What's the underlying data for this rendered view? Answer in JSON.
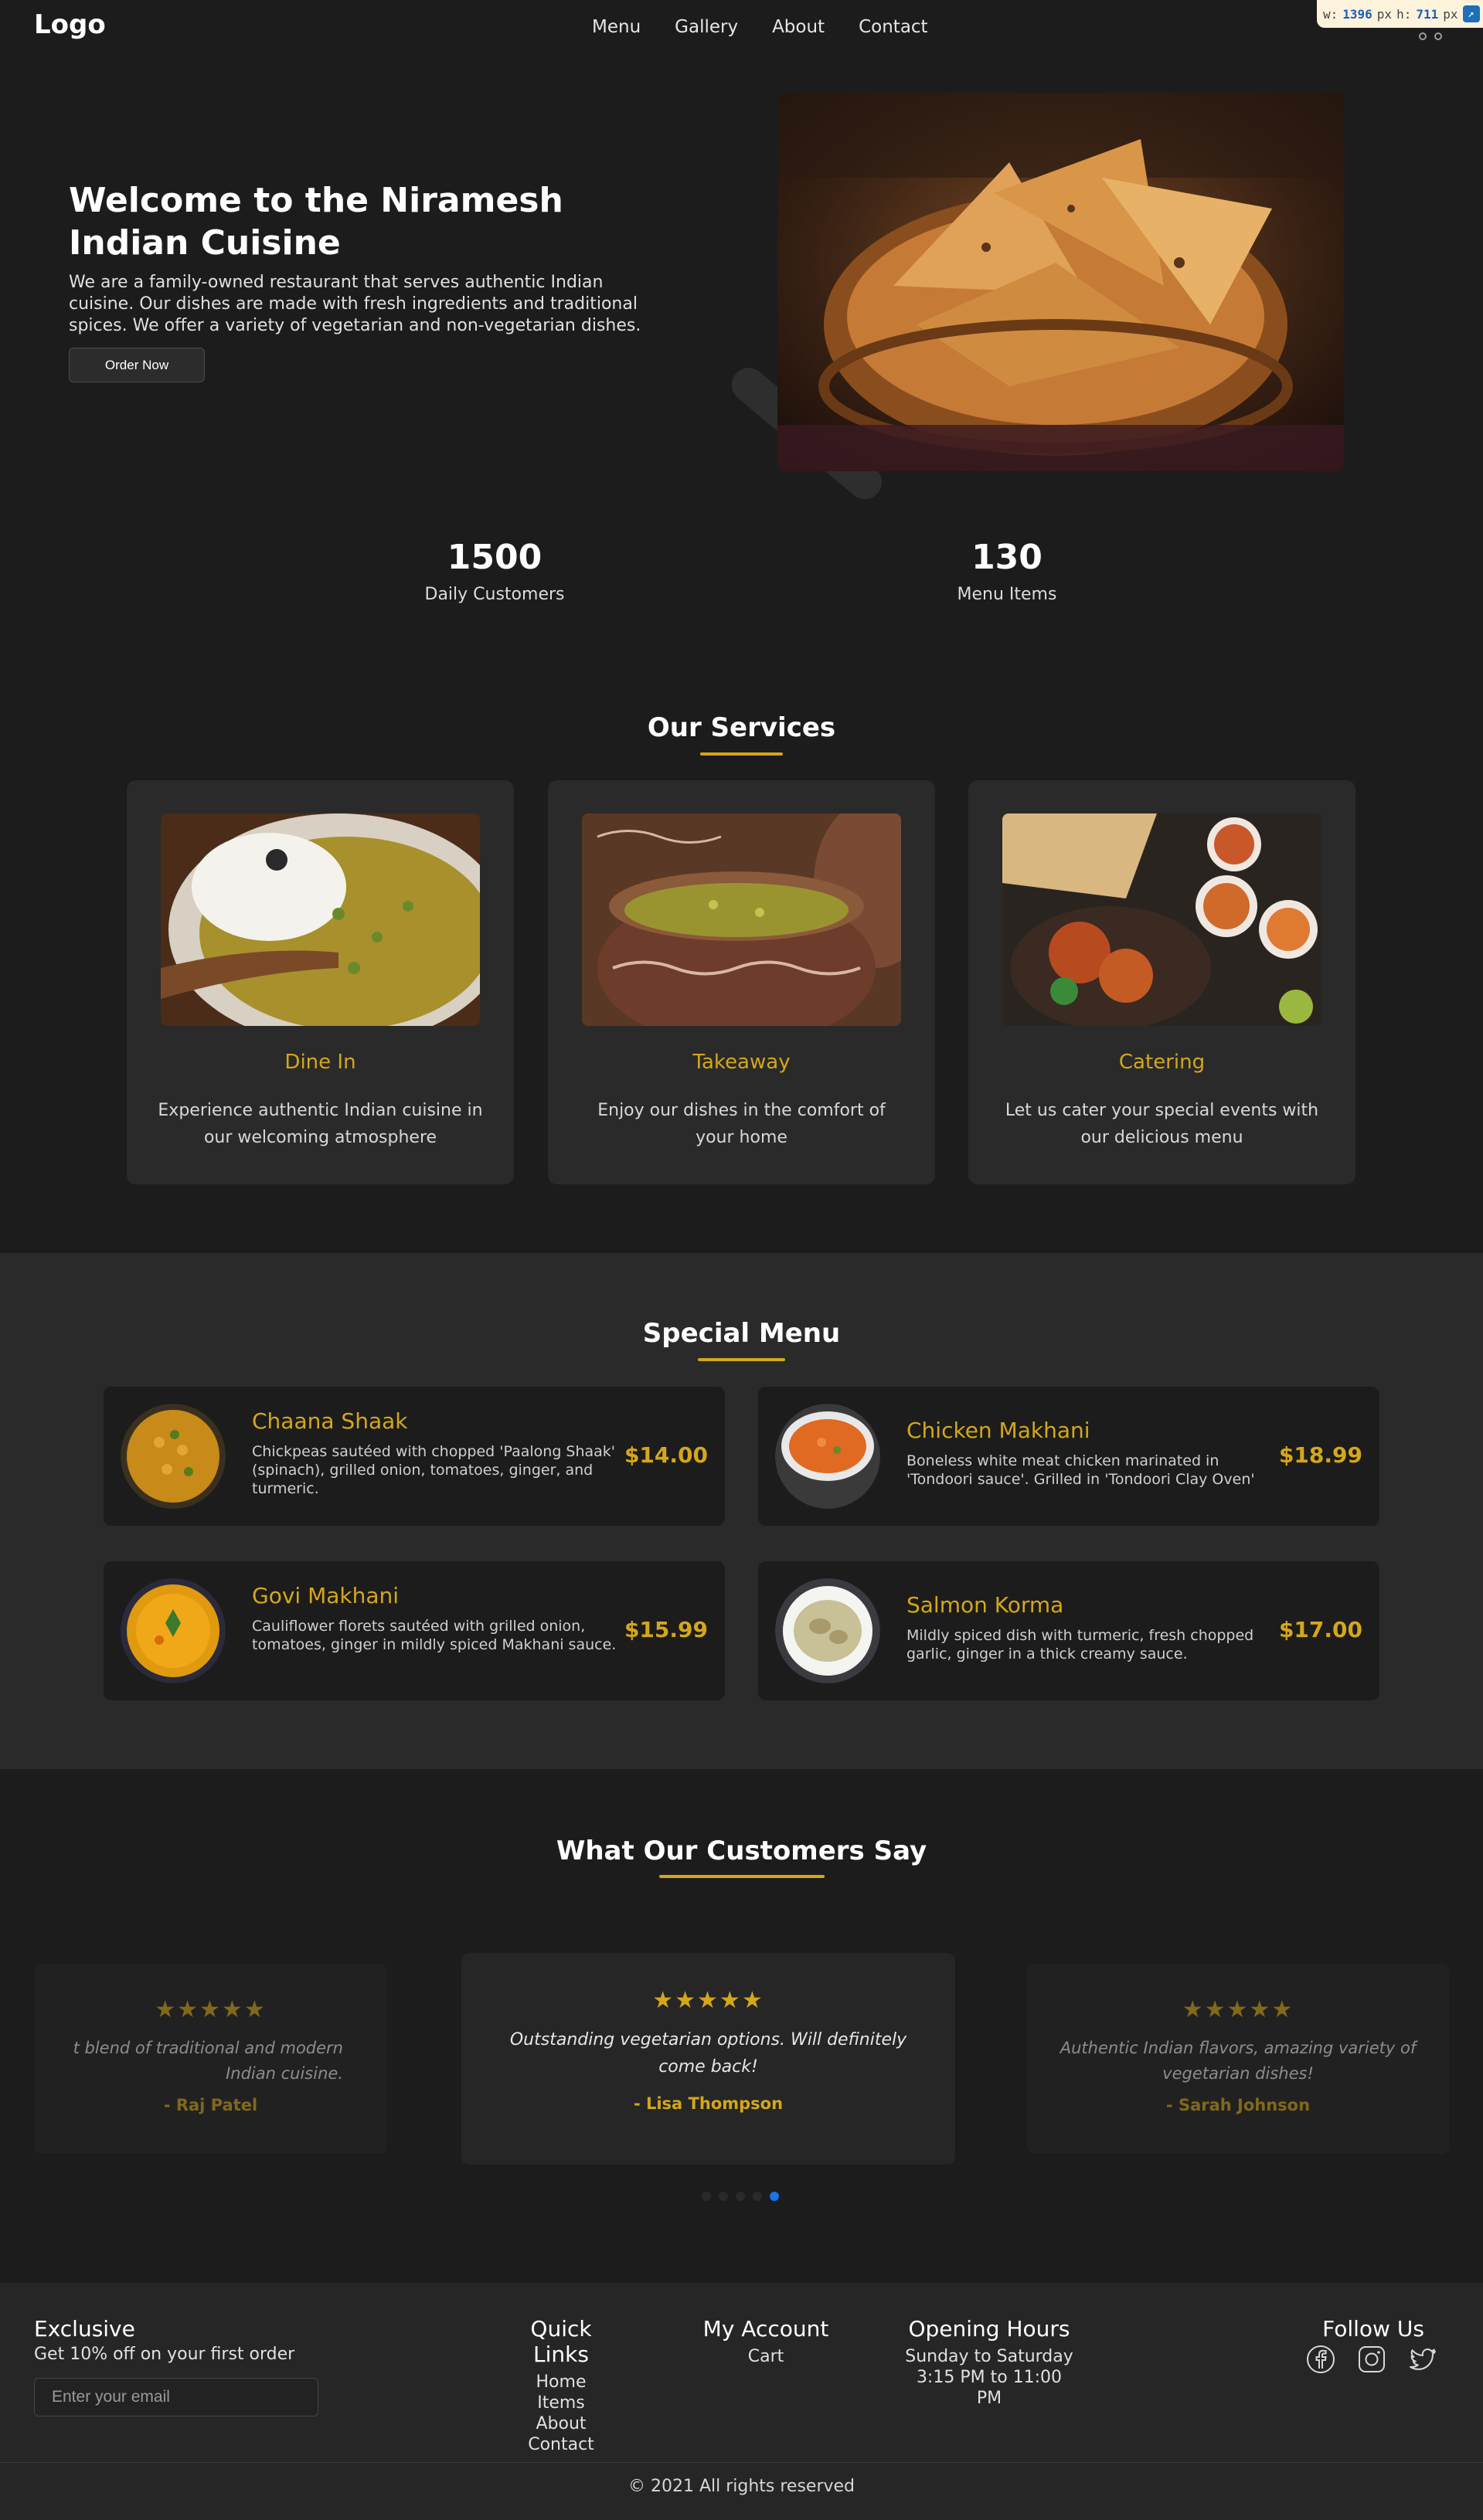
{
  "header": {
    "logo": "Logo",
    "nav": [
      "Menu",
      "Gallery",
      "About",
      "Contact"
    ]
  },
  "devtools": {
    "w_label": "w:",
    "w_value": "1396",
    "w_unit": "px",
    "h_label": "h:",
    "h_value": "711",
    "h_unit": "px"
  },
  "hero": {
    "title": "Welcome to the Niramesh Indian Cuisine",
    "text": "We are a family-owned restaurant that serves authentic Indian cuisine. Our dishes are made with fresh ingredients and traditional spices. We offer a variety of vegetarian and non-vegetarian dishes.",
    "button": "Order Now"
  },
  "stats": [
    {
      "value": "1500",
      "label": "Daily Customers"
    },
    {
      "value": "130",
      "label": "Menu Items"
    }
  ],
  "services": {
    "title": "Our Services",
    "items": [
      {
        "title": "Dine In",
        "desc": "Experience authentic Indian cuisine in our welcoming atmosphere"
      },
      {
        "title": "Takeaway",
        "desc": "Enjoy our dishes in the comfort of your home"
      },
      {
        "title": "Catering",
        "desc": "Let us cater your special events with our delicious menu"
      }
    ]
  },
  "special_menu": {
    "title": "Special Menu",
    "items": [
      {
        "name": "Chaana Shaak",
        "desc": "Chickpeas sautéed with chopped 'Paalong Shaak' (spinach), grilled onion, tomatoes, ginger, and turmeric.",
        "price": "$14.00"
      },
      {
        "name": "Chicken Makhani",
        "desc": "Boneless white meat chicken marinated in 'Tondoori sauce'. Grilled in 'Tondoori Clay Oven'",
        "price": "$18.99"
      },
      {
        "name": "Govi Makhani",
        "desc": "Cauliflower florets sautéed with grilled onion, tomatoes, ginger in mildly spiced Makhani sauce.",
        "price": "$15.99"
      },
      {
        "name": "Salmon Korma",
        "desc": "Mildly spiced dish with turmeric, fresh chopped garlic, ginger in a thick creamy sauce.",
        "price": "$17.00"
      }
    ]
  },
  "testimonials": {
    "title": "What Our Customers Say",
    "stars": "★★★★★",
    "items": [
      {
        "text": "t blend of traditional and modern Indian cuisine.",
        "author": "- Raj Patel"
      },
      {
        "text": "Outstanding vegetarian options. Will definitely come back!",
        "author": "- Lisa Thompson"
      },
      {
        "text": "Authentic Indian flavors, amazing variety of vegetarian dishes!",
        "author": "- Sarah Johnson"
      }
    ],
    "active_dot": 4
  },
  "footer": {
    "exclusive_title": "Exclusive",
    "exclusive_text": "Get 10% off on your first order",
    "email_placeholder": "Enter your email",
    "quick_links_title": "Quick Links",
    "quick_links": [
      "Home",
      "Items",
      "About",
      "Contact"
    ],
    "account_title": "My Account",
    "account_links": [
      "Cart"
    ],
    "hours_title": "Opening Hours",
    "hours_days": "Sunday to Saturday",
    "hours_time": "3:15 PM to 11:00 PM",
    "follow_title": "Follow Us",
    "social_icons": [
      "facebook-icon",
      "instagram-icon",
      "twitter-icon"
    ],
    "copyright": "© 2021 All rights reserved"
  },
  "colors": {
    "background": "#1c1c1c",
    "card": "#2a2a2a",
    "accent": "#d4a71b",
    "active_dot": "#1a73e8"
  }
}
